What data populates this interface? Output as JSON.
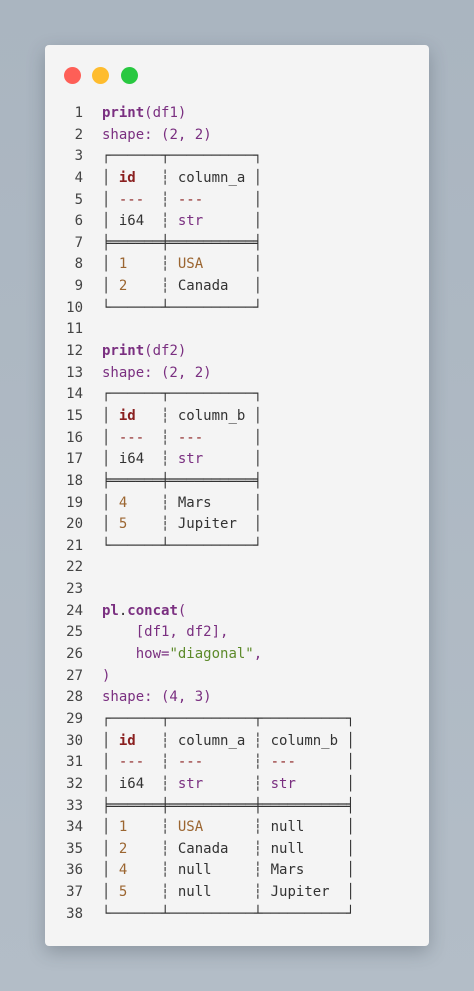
{
  "window": {
    "controls": [
      "close",
      "minimize",
      "zoom"
    ]
  },
  "lines": [
    {
      "n": "1",
      "tokens": [
        {
          "t": "print",
          "c": "fn"
        },
        {
          "t": "(df1)",
          "c": "purple"
        }
      ]
    },
    {
      "n": "2",
      "tokens": [
        {
          "t": "shape",
          "c": "purple"
        },
        {
          "t": ": (",
          "c": "purple"
        },
        {
          "t": "2",
          "c": "purple"
        },
        {
          "t": ", ",
          "c": "purple"
        },
        {
          "t": "2",
          "c": "purple"
        },
        {
          "t": ")",
          "c": "purple"
        }
      ]
    },
    {
      "n": "3",
      "tokens": [
        {
          "t": "┌──────┬──────────┐",
          "c": "box"
        }
      ]
    },
    {
      "n": "4",
      "tokens": [
        {
          "t": "│ ",
          "c": "box"
        },
        {
          "t": "id",
          "c": "hdr"
        },
        {
          "t": "   ┆ ",
          "c": "box"
        },
        {
          "t": "column_a",
          "c": "cell"
        },
        {
          "t": " │",
          "c": "box"
        }
      ]
    },
    {
      "n": "5",
      "tokens": [
        {
          "t": "│ ",
          "c": "box"
        },
        {
          "t": "---",
          "c": "dash"
        },
        {
          "t": "  ┆ ",
          "c": "box"
        },
        {
          "t": "---",
          "c": "dash"
        },
        {
          "t": "      │",
          "c": "box"
        }
      ]
    },
    {
      "n": "6",
      "tokens": [
        {
          "t": "│ ",
          "c": "box"
        },
        {
          "t": "i64",
          "c": "cell"
        },
        {
          "t": "  ┆ ",
          "c": "box"
        },
        {
          "t": "str",
          "c": "type"
        },
        {
          "t": "      │",
          "c": "box"
        }
      ]
    },
    {
      "n": "7",
      "tokens": [
        {
          "t": "╞══════╪══════════╡",
          "c": "box"
        }
      ]
    },
    {
      "n": "8",
      "tokens": [
        {
          "t": "│ ",
          "c": "box"
        },
        {
          "t": "1",
          "c": "num"
        },
        {
          "t": "    ┆ ",
          "c": "box"
        },
        {
          "t": "USA",
          "c": "num"
        },
        {
          "t": "      │",
          "c": "box"
        }
      ]
    },
    {
      "n": "9",
      "tokens": [
        {
          "t": "│ ",
          "c": "box"
        },
        {
          "t": "2",
          "c": "num"
        },
        {
          "t": "    ┆ ",
          "c": "box"
        },
        {
          "t": "Canada",
          "c": "cell"
        },
        {
          "t": "   │",
          "c": "box"
        }
      ]
    },
    {
      "n": "10",
      "tokens": [
        {
          "t": "└──────┴──────────┘",
          "c": "box"
        }
      ]
    },
    {
      "n": "11",
      "tokens": []
    },
    {
      "n": "12",
      "tokens": [
        {
          "t": "print",
          "c": "fn"
        },
        {
          "t": "(df2)",
          "c": "purple"
        }
      ]
    },
    {
      "n": "13",
      "tokens": [
        {
          "t": "shape: (2, 2)",
          "c": "purple"
        }
      ]
    },
    {
      "n": "14",
      "tokens": [
        {
          "t": "┌──────┬──────────┐",
          "c": "box"
        }
      ]
    },
    {
      "n": "15",
      "tokens": [
        {
          "t": "│ ",
          "c": "box"
        },
        {
          "t": "id",
          "c": "hdr"
        },
        {
          "t": "   ┆ ",
          "c": "box"
        },
        {
          "t": "column_b",
          "c": "cell"
        },
        {
          "t": " │",
          "c": "box"
        }
      ]
    },
    {
      "n": "16",
      "tokens": [
        {
          "t": "│ ",
          "c": "box"
        },
        {
          "t": "---",
          "c": "dash"
        },
        {
          "t": "  ┆ ",
          "c": "box"
        },
        {
          "t": "---",
          "c": "dash"
        },
        {
          "t": "      │",
          "c": "box"
        }
      ]
    },
    {
      "n": "17",
      "tokens": [
        {
          "t": "│ ",
          "c": "box"
        },
        {
          "t": "i64",
          "c": "cell"
        },
        {
          "t": "  ┆ ",
          "c": "box"
        },
        {
          "t": "str",
          "c": "type"
        },
        {
          "t": "      │",
          "c": "box"
        }
      ]
    },
    {
      "n": "18",
      "tokens": [
        {
          "t": "╞══════╪══════════╡",
          "c": "box"
        }
      ]
    },
    {
      "n": "19",
      "tokens": [
        {
          "t": "│ ",
          "c": "box"
        },
        {
          "t": "4",
          "c": "num"
        },
        {
          "t": "    ┆ ",
          "c": "box"
        },
        {
          "t": "Mars",
          "c": "cell"
        },
        {
          "t": "     │",
          "c": "box"
        }
      ]
    },
    {
      "n": "20",
      "tokens": [
        {
          "t": "│ ",
          "c": "box"
        },
        {
          "t": "5",
          "c": "num"
        },
        {
          "t": "    ┆ ",
          "c": "box"
        },
        {
          "t": "Jupiter",
          "c": "cell"
        },
        {
          "t": "  │",
          "c": "box"
        }
      ]
    },
    {
      "n": "21",
      "tokens": [
        {
          "t": "└──────┴──────────┘",
          "c": "box"
        }
      ]
    },
    {
      "n": "22",
      "tokens": []
    },
    {
      "n": "23",
      "tokens": []
    },
    {
      "n": "24",
      "tokens": [
        {
          "t": "pl",
          "c": "fn"
        },
        {
          "t": ".",
          "c": "plain"
        },
        {
          "t": "concat",
          "c": "fn"
        },
        {
          "t": "(",
          "c": "purple"
        }
      ]
    },
    {
      "n": "25",
      "tokens": [
        {
          "t": "    [df1, df2],",
          "c": "purple"
        }
      ]
    },
    {
      "n": "26",
      "tokens": [
        {
          "t": "    how=",
          "c": "purple"
        },
        {
          "t": "\"diagonal\"",
          "c": "str"
        },
        {
          "t": ",",
          "c": "purple"
        }
      ]
    },
    {
      "n": "27",
      "tokens": [
        {
          "t": ")",
          "c": "purple"
        }
      ]
    },
    {
      "n": "28",
      "tokens": [
        {
          "t": "shape: (4, 3)",
          "c": "purple"
        }
      ]
    },
    {
      "n": "29",
      "tokens": [
        {
          "t": "┌──────┬──────────┬──────────┐",
          "c": "box"
        }
      ]
    },
    {
      "n": "30",
      "tokens": [
        {
          "t": "│ ",
          "c": "box"
        },
        {
          "t": "id",
          "c": "hdr"
        },
        {
          "t": "   ┆ ",
          "c": "box"
        },
        {
          "t": "column_a",
          "c": "cell"
        },
        {
          "t": " ┆ ",
          "c": "box"
        },
        {
          "t": "column_b",
          "c": "cell"
        },
        {
          "t": " │",
          "c": "box"
        }
      ]
    },
    {
      "n": "31",
      "tokens": [
        {
          "t": "│ ",
          "c": "box"
        },
        {
          "t": "---",
          "c": "dash"
        },
        {
          "t": "  ┆ ",
          "c": "box"
        },
        {
          "t": "---",
          "c": "dash"
        },
        {
          "t": "      ┆ ",
          "c": "box"
        },
        {
          "t": "---",
          "c": "dash"
        },
        {
          "t": "      │",
          "c": "box"
        }
      ]
    },
    {
      "n": "32",
      "tokens": [
        {
          "t": "│ ",
          "c": "box"
        },
        {
          "t": "i64",
          "c": "cell"
        },
        {
          "t": "  ┆ ",
          "c": "box"
        },
        {
          "t": "str",
          "c": "type"
        },
        {
          "t": "      ┆ ",
          "c": "box"
        },
        {
          "t": "str",
          "c": "type"
        },
        {
          "t": "      │",
          "c": "box"
        }
      ]
    },
    {
      "n": "33",
      "tokens": [
        {
          "t": "╞══════╪══════════╪══════════╡",
          "c": "box"
        }
      ]
    },
    {
      "n": "34",
      "tokens": [
        {
          "t": "│ ",
          "c": "box"
        },
        {
          "t": "1",
          "c": "num"
        },
        {
          "t": "    ┆ ",
          "c": "box"
        },
        {
          "t": "USA",
          "c": "num"
        },
        {
          "t": "      ┆ ",
          "c": "box"
        },
        {
          "t": "null",
          "c": "cell"
        },
        {
          "t": "     │",
          "c": "box"
        }
      ]
    },
    {
      "n": "35",
      "tokens": [
        {
          "t": "│ ",
          "c": "box"
        },
        {
          "t": "2",
          "c": "num"
        },
        {
          "t": "    ┆ ",
          "c": "box"
        },
        {
          "t": "Canada",
          "c": "cell"
        },
        {
          "t": "   ┆ ",
          "c": "box"
        },
        {
          "t": "null",
          "c": "cell"
        },
        {
          "t": "     │",
          "c": "box"
        }
      ]
    },
    {
      "n": "36",
      "tokens": [
        {
          "t": "│ ",
          "c": "box"
        },
        {
          "t": "4",
          "c": "num"
        },
        {
          "t": "    ┆ ",
          "c": "box"
        },
        {
          "t": "null",
          "c": "cell"
        },
        {
          "t": "     ┆ ",
          "c": "box"
        },
        {
          "t": "Mars",
          "c": "cell"
        },
        {
          "t": "     │",
          "c": "box"
        }
      ]
    },
    {
      "n": "37",
      "tokens": [
        {
          "t": "│ ",
          "c": "box"
        },
        {
          "t": "5",
          "c": "num"
        },
        {
          "t": "    ┆ ",
          "c": "box"
        },
        {
          "t": "null",
          "c": "cell"
        },
        {
          "t": "     ┆ ",
          "c": "box"
        },
        {
          "t": "Jupiter",
          "c": "cell"
        },
        {
          "t": "  │",
          "c": "box"
        }
      ]
    },
    {
      "n": "38",
      "tokens": [
        {
          "t": "└──────┴──────────┴──────────┘",
          "c": "box"
        }
      ]
    }
  ],
  "colors": {
    "close": "#fe5f57",
    "minimize": "#febc2e",
    "zoom": "#28c840",
    "keyword": "#7a2f80",
    "header": "#8a1f1f",
    "number": "#9b6530",
    "string": "#5d8a2a"
  }
}
